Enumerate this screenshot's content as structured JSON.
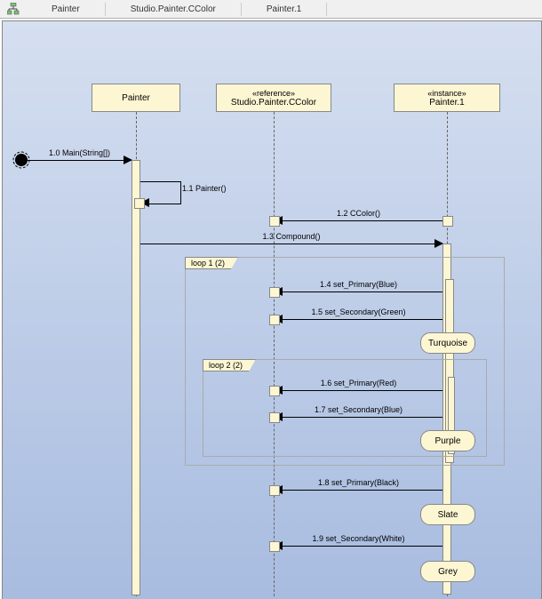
{
  "tabs": [
    "Painter",
    "Studio.Painter.CColor",
    "Painter.1"
  ],
  "objects": {
    "a": {
      "name": "Painter",
      "stereo": null
    },
    "b": {
      "name": "Studio.Painter.CColor",
      "stereo": "«reference»"
    },
    "c": {
      "name": "Painter.1",
      "stereo": "«instance»"
    }
  },
  "messages": {
    "m0": "1.0 Main(String[])",
    "m1": "1.1 Painter()",
    "m2": "1.2 CColor()",
    "m3": "1.3 Compound()",
    "m4": "1.4 set_Primary(Blue)",
    "m5": "1.5 set_Secondary(Green)",
    "m6": "1.6 set_Primary(Red)",
    "m7": "1.7 set_Secondary(Blue)",
    "m8": "1.8 set_Primary(Black)",
    "m9": "1.9 set_Secondary(White)"
  },
  "loops": {
    "l1": "loop 1 (2)",
    "l2": "loop 2 (2)"
  },
  "states": {
    "s1": "Turquoise",
    "s2": "Purple",
    "s3": "Slate",
    "s4": "Grey"
  },
  "chart_data": {
    "type": "uml-sequence-diagram",
    "lifelines": [
      {
        "name": "Painter",
        "stereotype": null
      },
      {
        "name": "Studio.Painter.CColor",
        "stereotype": "reference"
      },
      {
        "name": "Painter.1",
        "stereotype": "instance"
      }
    ],
    "messages": [
      {
        "seq": "1.0",
        "label": "Main(String[])",
        "from": "external",
        "to": "Painter",
        "kind": "found"
      },
      {
        "seq": "1.1",
        "label": "Painter()",
        "from": "Painter",
        "to": "Painter",
        "kind": "self"
      },
      {
        "seq": "1.2",
        "label": "CColor()",
        "from": "Painter.1",
        "to": "Studio.Painter.CColor",
        "kind": "call"
      },
      {
        "seq": "1.3",
        "label": "Compound()",
        "from": "Painter",
        "to": "Painter.1",
        "kind": "call"
      },
      {
        "seq": "1.4",
        "label": "set_Primary(Blue)",
        "from": "Painter.1",
        "to": "Studio.Painter.CColor",
        "kind": "call"
      },
      {
        "seq": "1.5",
        "label": "set_Secondary(Green)",
        "from": "Painter.1",
        "to": "Studio.Painter.CColor",
        "kind": "call"
      },
      {
        "seq": "1.6",
        "label": "set_Primary(Red)",
        "from": "Painter.1",
        "to": "Studio.Painter.CColor",
        "kind": "call"
      },
      {
        "seq": "1.7",
        "label": "set_Secondary(Blue)",
        "from": "Painter.1",
        "to": "Studio.Painter.CColor",
        "kind": "call"
      },
      {
        "seq": "1.8",
        "label": "set_Primary(Black)",
        "from": "Painter.1",
        "to": "Studio.Painter.CColor",
        "kind": "call"
      },
      {
        "seq": "1.9",
        "label": "set_Secondary(White)",
        "from": "Painter.1",
        "to": "Studio.Painter.CColor",
        "kind": "call"
      }
    ],
    "fragments": [
      {
        "type": "loop",
        "label": "loop 1 (2)",
        "encloses": [
          "1.4",
          "1.5",
          "1.6",
          "1.7"
        ],
        "states": [
          "Turquoise",
          "Purple"
        ]
      },
      {
        "type": "loop",
        "label": "loop 2 (2)",
        "encloses": [
          "1.6",
          "1.7"
        ],
        "states": [
          "Purple"
        ],
        "nested_in": "loop 1 (2)"
      }
    ],
    "states_after": [
      {
        "after": "1.5",
        "lifeline": "Painter.1",
        "state": "Turquoise"
      },
      {
        "after": "1.7",
        "lifeline": "Painter.1",
        "state": "Purple"
      },
      {
        "after": "1.8",
        "lifeline": "Painter.1",
        "state": "Slate"
      },
      {
        "after": "1.9",
        "lifeline": "Painter.1",
        "state": "Grey"
      }
    ]
  }
}
